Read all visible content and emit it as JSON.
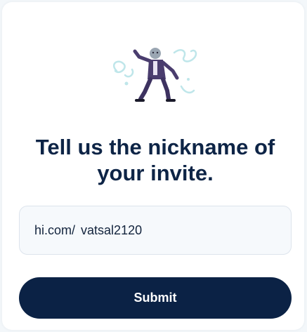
{
  "illustration": {
    "icon": "dancing-man-illustration-icon"
  },
  "heading": "Tell us the nickname of your invite.",
  "nickname": {
    "prefix": "hi.com/",
    "value": "vatsal2120"
  },
  "submit_label": "Submit",
  "colors": {
    "primary": "#0b2245",
    "heading": "#0d2446",
    "input_bg": "#f6f9fc",
    "input_border": "#dde4ec",
    "page_bg": "#f3f7fa"
  }
}
